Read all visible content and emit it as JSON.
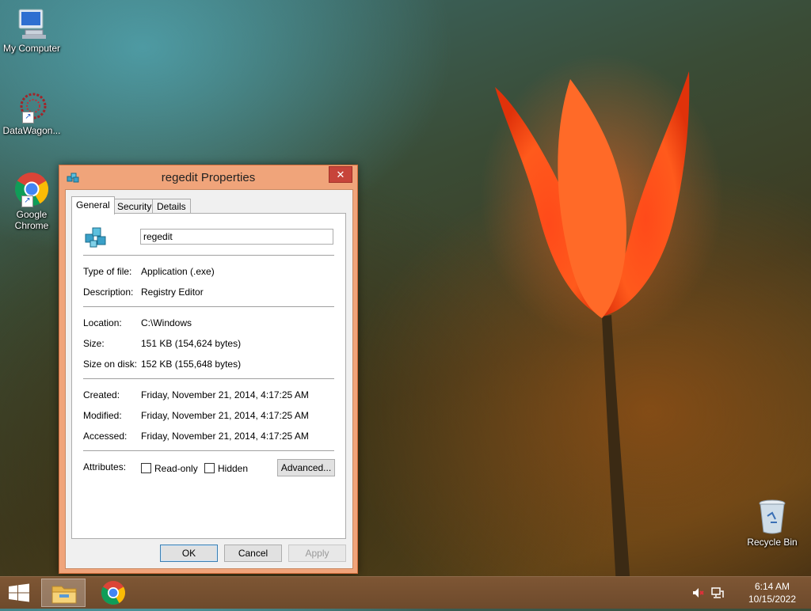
{
  "desktop": {
    "icons": [
      {
        "label": "My Computer"
      },
      {
        "label": "DataWagon..."
      },
      {
        "label": "Google Chrome"
      },
      {
        "label": "Recycle Bin"
      }
    ]
  },
  "dialog": {
    "title": "regedit Properties",
    "close_symbol": "✕",
    "tabs": [
      "General",
      "Security",
      "Details"
    ],
    "file_name": "regedit",
    "rows": {
      "type_label": "Type of file:",
      "type_value": "Application (.exe)",
      "desc_label": "Description:",
      "desc_value": "Registry Editor",
      "location_label": "Location:",
      "location_value": "C:\\Windows",
      "size_label": "Size:",
      "size_value": "151 KB (154,624 bytes)",
      "disk_label": "Size on disk:",
      "disk_value": "152 KB (155,648 bytes)",
      "created_label": "Created:",
      "created_value": "Friday, November 21, 2014, 4:17:25 AM",
      "modified_label": "Modified:",
      "modified_value": "Friday, November 21, 2014, 4:17:25 AM",
      "accessed_label": "Accessed:",
      "accessed_value": "Friday, November 21, 2014, 4:17:25 AM",
      "attributes_label": "Attributes:"
    },
    "checkboxes": {
      "readonly": "Read-only",
      "hidden": "Hidden"
    },
    "buttons": {
      "advanced": "Advanced...",
      "ok": "OK",
      "cancel": "Cancel",
      "apply": "Apply"
    }
  },
  "taskbar": {
    "time": "6:14 AM",
    "date": "10/15/2022"
  },
  "colors": {
    "dialog_frame": "#f0a47a",
    "close_button": "#c7443a",
    "taskbar": "#7e5634"
  }
}
